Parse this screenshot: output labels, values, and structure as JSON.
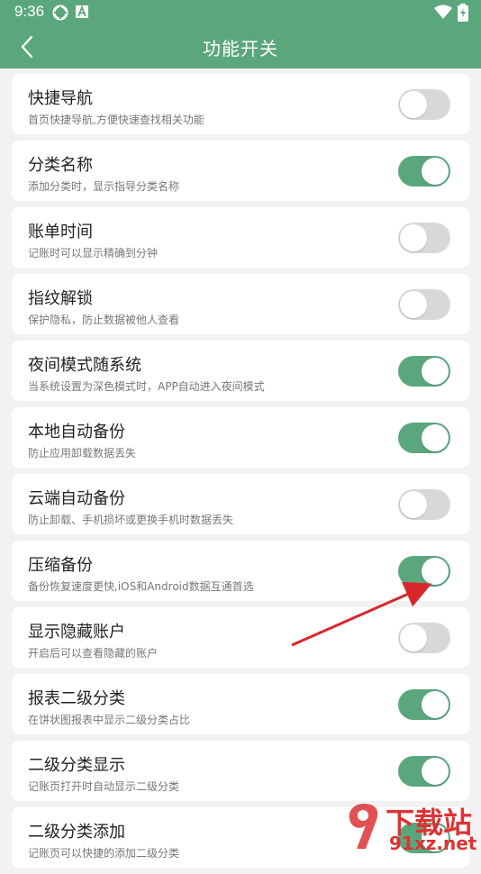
{
  "status_bar": {
    "time": "9:36"
  },
  "header": {
    "title": "功能开关",
    "back_icon": "back-arrow-icon",
    "bg_color": "#5ba77d"
  },
  "settings": [
    {
      "title": "快捷导航",
      "desc": "首页快捷导航,方便快速查找相关功能",
      "on": false
    },
    {
      "title": "分类名称",
      "desc": "添加分类时，显示指导分类名称",
      "on": true
    },
    {
      "title": "账单时间",
      "desc": "记账时可以显示精确到分钟",
      "on": false
    },
    {
      "title": "指纹解锁",
      "desc": "保护隐私，防止数据被他人查看",
      "on": false
    },
    {
      "title": "夜间模式随系统",
      "desc": "当系统设置为深色模式时，APP自动进入夜间模式",
      "on": true
    },
    {
      "title": "本地自动备份",
      "desc": "防止应用卸载数据丢失",
      "on": true
    },
    {
      "title": "云端自动备份",
      "desc": "防止卸载、手机损坏或更换手机时数据丢失",
      "on": false
    },
    {
      "title": "压缩备份",
      "desc": "备份恢复速度更快,iOS和Android数据互通首选",
      "on": true
    },
    {
      "title": "显示隐藏账户",
      "desc": "开启后可以查看隐藏的账户",
      "on": false
    },
    {
      "title": "报表二级分类",
      "desc": "在饼状图报表中显示二级分类占比",
      "on": true
    },
    {
      "title": "二级分类显示",
      "desc": "记账页打开时自动显示二级分类",
      "on": true
    },
    {
      "title": "二级分类添加",
      "desc": "记账页可以快捷的添加二级分类",
      "on": true
    }
  ],
  "watermark": {
    "text": "下载站",
    "url": "91xz.net"
  },
  "accent_color": "#5ba77d",
  "annotation_color": "#d9262b"
}
